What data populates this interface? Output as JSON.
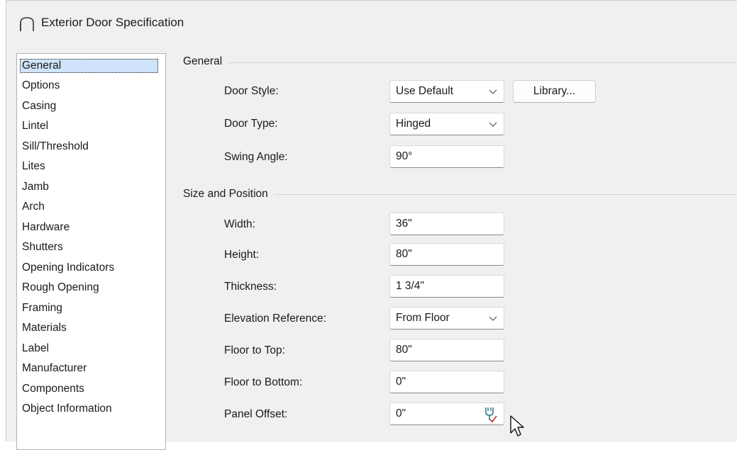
{
  "window": {
    "title": "Exterior Door Specification",
    "icon": "arch-door-icon"
  },
  "nav": {
    "items": [
      {
        "label": "General",
        "selected": true
      },
      {
        "label": "Options"
      },
      {
        "label": "Casing"
      },
      {
        "label": "Lintel"
      },
      {
        "label": "Sill/Threshold"
      },
      {
        "label": "Lites"
      },
      {
        "label": "Jamb"
      },
      {
        "label": "Arch"
      },
      {
        "label": "Hardware"
      },
      {
        "label": "Shutters"
      },
      {
        "label": "Opening Indicators"
      },
      {
        "label": "Rough Opening"
      },
      {
        "label": "Framing"
      },
      {
        "label": "Materials"
      },
      {
        "label": "Label"
      },
      {
        "label": "Manufacturer"
      },
      {
        "label": "Components"
      },
      {
        "label": "Object Information"
      }
    ]
  },
  "general": {
    "section_title": "General",
    "door_style": {
      "label": "Door Style:",
      "value": "Use Default"
    },
    "library_button": "Library...",
    "door_type": {
      "label": "Door Type:",
      "value": "Hinged"
    },
    "swing_angle": {
      "label": "Swing Angle:",
      "value": "90°"
    }
  },
  "size": {
    "section_title": "Size and Position",
    "width": {
      "label": "Width:",
      "value": "36\""
    },
    "height": {
      "label": "Height:",
      "value": "80\""
    },
    "thickness": {
      "label": "Thickness:",
      "value": "1 3/4\""
    },
    "elevation_reference": {
      "label": "Elevation Reference:",
      "value": "From Floor"
    },
    "floor_to_top": {
      "label": "Floor to Top:",
      "value": "80\""
    },
    "floor_to_bottom": {
      "label": "Floor to Bottom:",
      "value": "0\""
    },
    "panel_offset": {
      "label": "Panel Offset:",
      "value": "0\""
    }
  },
  "icons": {
    "dropdown": "chevron-down-icon",
    "field_tool": "edit-tool-icon",
    "cursor": "mouse-pointer-icon"
  }
}
